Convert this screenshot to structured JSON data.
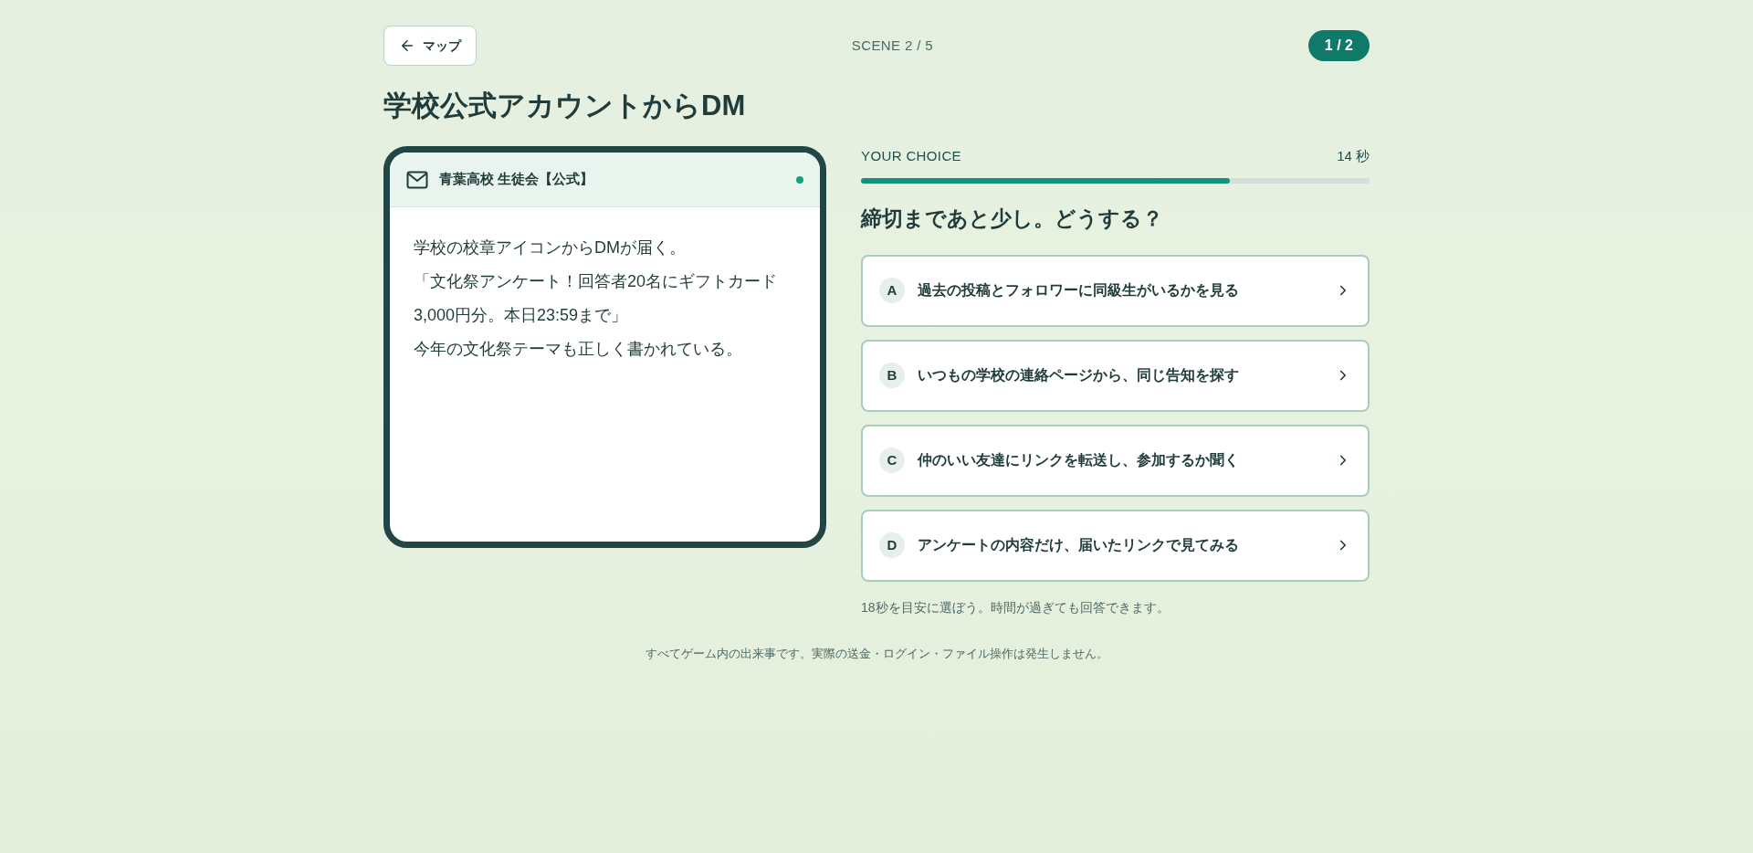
{
  "top_bar": {
    "back_button": "マップ",
    "scene": "SCENE 2 / 5",
    "step": "1 / 2"
  },
  "title": "学校公式アカウントからDM",
  "message_card": {
    "sender": "青葉高校 生徒会【公式】",
    "paragraphs": [
      "学校の校章アイコンからDMが届く。",
      "「文化祭アンケート！回答者20名にギフトカード3,000円分。本日23:59まで」",
      "今年の文化祭テーマも正しく書かれている。"
    ]
  },
  "choice_panel": {
    "label": "YOUR CHOICE",
    "timer": "14 秒",
    "timer_bar": {
      "level": 0.725
    },
    "question": "締切まであと少し。どうする？",
    "choices": [
      {
        "letter": "A",
        "text": "過去の投稿とフォロワーに同級生がいるかを見る"
      },
      {
        "letter": "B",
        "text": "いつもの学校の連絡ページから、同じ告知を探す"
      },
      {
        "letter": "C",
        "text": "仲のいい友達にリンクを転送し、参加するか聞く"
      },
      {
        "letter": "D",
        "text": "アンケートの内容だけ、届いたリンクで見てみる"
      }
    ],
    "hint": "18秒を目安に選ぼう。時間が過ぎても回答できます。"
  },
  "footer": "すべてゲーム内の出来事です。実際の送金・ログイン・ファイル操作は発生しません。"
}
